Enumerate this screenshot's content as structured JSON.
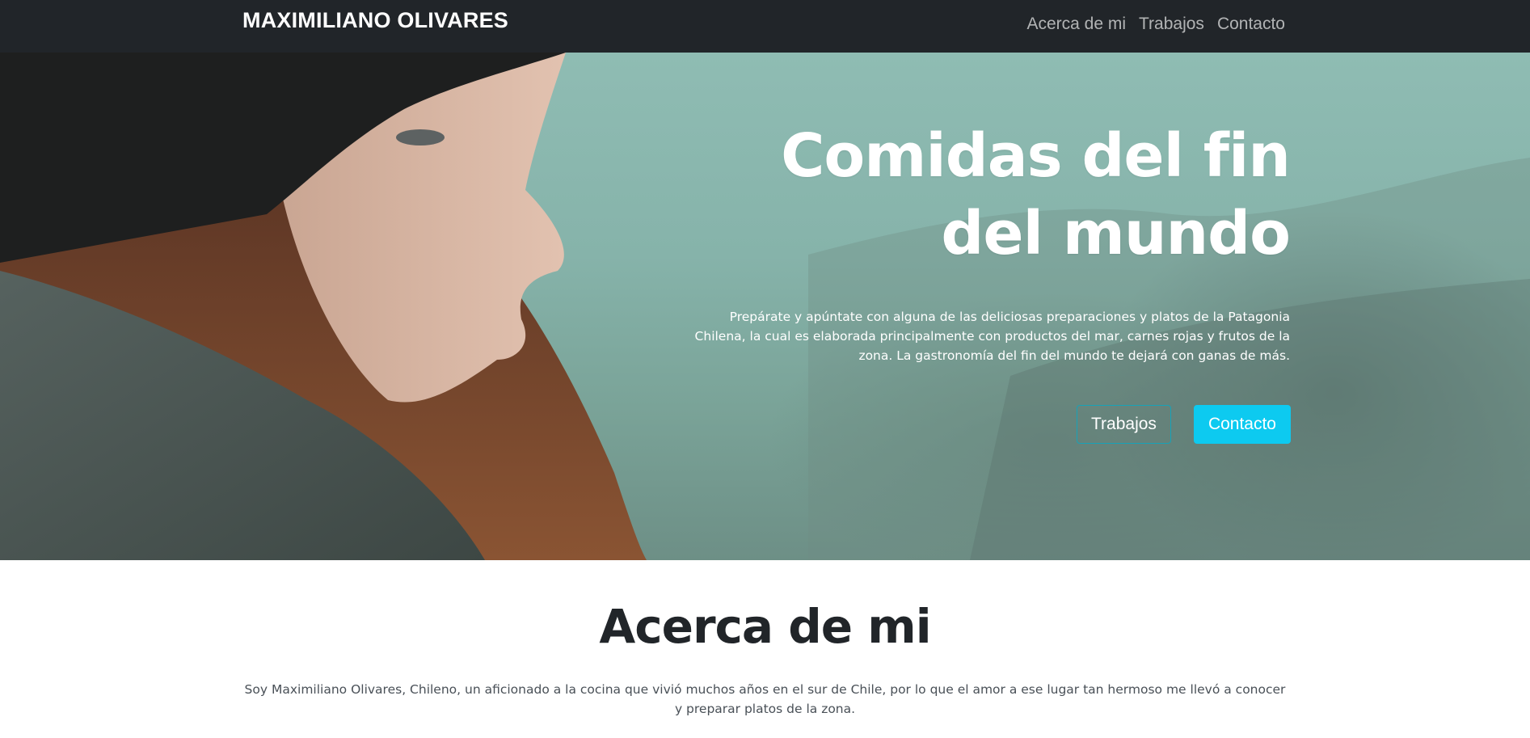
{
  "navbar": {
    "brand": "MAXIMILIANO OLIVARES",
    "links": [
      {
        "label": "Acerca de mi"
      },
      {
        "label": "Trabajos"
      },
      {
        "label": "Contacto"
      }
    ],
    "background": "#212529"
  },
  "hero": {
    "title": "Comidas del fin\ndel mundo",
    "lead": "Prepárate y apúntate con alguna de las deliciosas preparaciones y platos de la Patagonia Chilena, la cual es elaborada principalmente con productos del mar, carnes rojas y frutos de la zona. La gastronomía del fin del mundo te dejará con ganas de más.",
    "buttons": {
      "secondary_label": "Trabajos",
      "primary_label": "Contacto"
    },
    "accent_color": "#0dcaf0"
  },
  "about": {
    "title": "Acerca de mi",
    "text": "Soy Maximiliano Olivares, Chileno, un aficionado a la cocina que vivió muchos años en el sur de Chile, por lo que el amor a ese lugar tan hermoso me llevó a conocer y preparar platos de la zona."
  }
}
